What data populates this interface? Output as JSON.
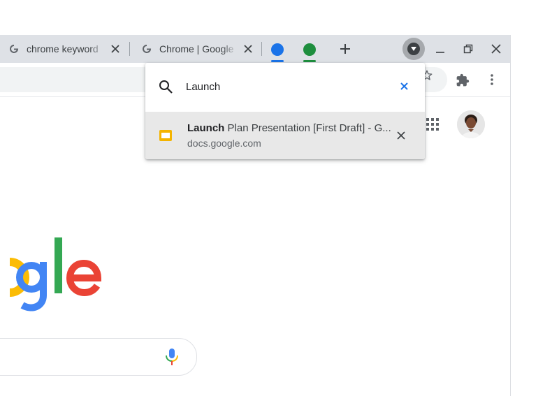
{
  "tabs": [
    {
      "title": "chrome keyword",
      "favicon": "google-g-icon"
    },
    {
      "title": "Chrome | Google",
      "favicon": "google-g-icon"
    }
  ],
  "tab_groups": [
    {
      "color": "#1a73e8"
    },
    {
      "color": "#1e8e3e"
    }
  ],
  "icons": {
    "new_tab": "plus-icon",
    "tab_search": "tab-search-icon",
    "minimize": "minimize-icon",
    "restore": "restore-icon",
    "close": "close-icon",
    "bookmark": "star-icon",
    "extensions": "puzzle-icon",
    "menu": "more-vert-icon",
    "apps": "apps-grid-icon",
    "mic": "mic-icon"
  },
  "tab_search": {
    "query": "Launch",
    "result": {
      "title_bold": "Launch",
      "title_rest": " Plan Presentation [First Draft] - Google Slides",
      "url": "docs.google.com"
    }
  },
  "page": {
    "logo_visible_text": "ogle"
  },
  "colors": {
    "tabstrip": "#dee1e6",
    "accent_blue": "#1a73e8",
    "google_blue": "#4285f4",
    "google_red": "#ea4335",
    "google_yellow": "#fbbc05",
    "google_green": "#34a853"
  }
}
